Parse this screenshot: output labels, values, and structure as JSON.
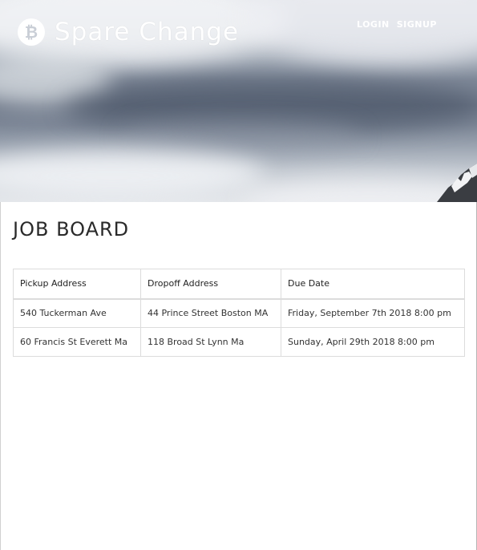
{
  "brand": {
    "logo_glyph": "₿",
    "name": "Spare Change"
  },
  "nav": {
    "login": "Login",
    "signup": "Signup"
  },
  "page": {
    "title": "Job Board"
  },
  "table": {
    "headers": [
      "Pickup Address",
      "Dropoff Address",
      "Due Date"
    ],
    "rows": [
      [
        "540 Tuckerman Ave",
        "44 Prince Street Boston MA",
        "Friday, September 7th 2018 8:00 pm"
      ],
      [
        "60 Francis St Everett Ma",
        "118 Broad St Lynn Ma",
        "Sunday, April 29th 2018 8:00 pm"
      ]
    ]
  },
  "colors": {
    "hero_sky": "#7d8797",
    "brand_text": "#ffffff",
    "border": "#dcdcdc"
  }
}
